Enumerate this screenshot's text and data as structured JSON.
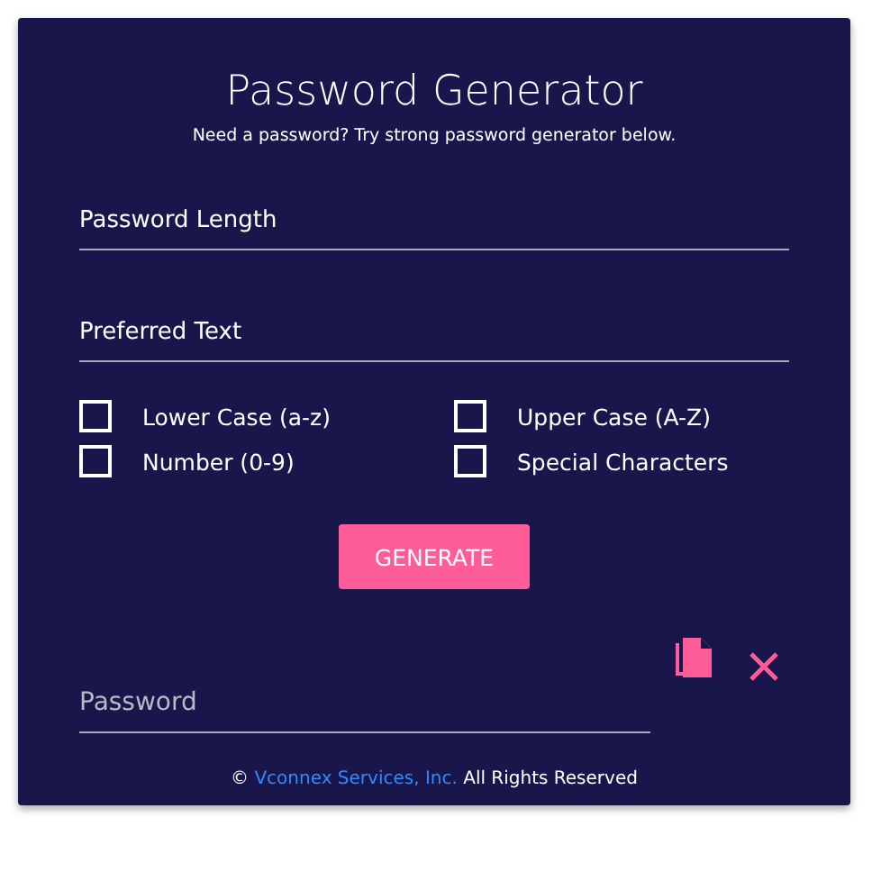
{
  "title": "Password Generator",
  "subtitle": "Need a password? Try strong password generator below.",
  "fields": [
    {
      "placeholder": "Password Length"
    },
    {
      "placeholder": "Preferred Text"
    }
  ],
  "options": [
    {
      "label": "Lower Case (a-z)",
      "checked": false
    },
    {
      "label": "Upper Case (A-Z)",
      "checked": false
    },
    {
      "label": "Number (0-9)",
      "checked": false
    },
    {
      "label": "Special Characters",
      "checked": false
    }
  ],
  "generate_button": "GENERATE",
  "output": {
    "placeholder": "Password"
  },
  "footer": {
    "symbol": "©",
    "link": "Vconnex Services, Inc.",
    "text": "All Rights Reserved"
  }
}
